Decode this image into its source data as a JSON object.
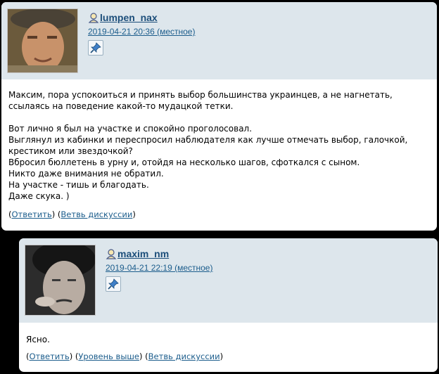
{
  "comments": [
    {
      "username": "lumpen_nax",
      "date": "2019-04-21 20:36 (местное)",
      "text": "Максим, пора успокоиться и принять выбор большинства украинцев, а не нагнетать, ссылаясь на поведение какой-то мудацкой тетки.\n\nВот лично я был на участке и спокойно проголосовал.\nВыглянул из кабинки и переспросил наблюдателя как лучше отмечать выбор, галочкой, крестиком или звездочкой?\nВбросил бюллетень в урну и, отойдя на несколько шагов, сфоткался с сыном.\nНикто даже внимания не обратил.\nНа участке - тишь и благодать.\nДаже скука. )",
      "links": {
        "reply": "Ответить",
        "thread": "Ветвь дискуссии"
      }
    },
    {
      "username": "maxim_nm",
      "date": "2019-04-21 22:19 (местное)",
      "text": "Ясно.",
      "links": {
        "reply": "Ответить",
        "up": "Уровень выше",
        "thread": "Ветвь дискуссии"
      }
    }
  ],
  "colors": {
    "header_bg": "#dde6ec",
    "link": "#1c5d8c",
    "page_bg": "#000000"
  },
  "icons": {
    "user": "user-icon",
    "pin": "pin-icon"
  }
}
